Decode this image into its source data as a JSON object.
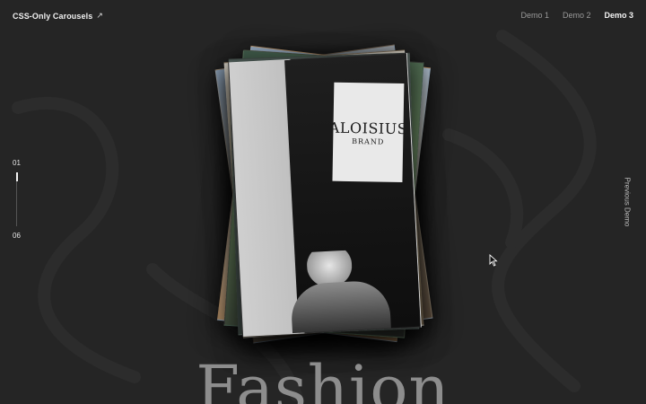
{
  "header": {
    "brand_label": "CSS-Only Carousels",
    "brand_icon": "arrow-up-right-icon",
    "nav": [
      {
        "label": "Demo 1",
        "active": false
      },
      {
        "label": "Demo 2",
        "active": false
      },
      {
        "label": "Demo 3",
        "active": true
      }
    ]
  },
  "counter": {
    "current": "01",
    "total": "06",
    "progress": 0.17
  },
  "side_link": {
    "label": "Previous Demo"
  },
  "slide": {
    "title": "Fashion",
    "patch_text_line1": "ALOISIUS",
    "patch_text_line2": "BRAND"
  },
  "colors": {
    "background": "#252525",
    "text_primary": "#f0f0f0",
    "text_muted": "#9a9a9a",
    "title": "#8d8d8d"
  }
}
